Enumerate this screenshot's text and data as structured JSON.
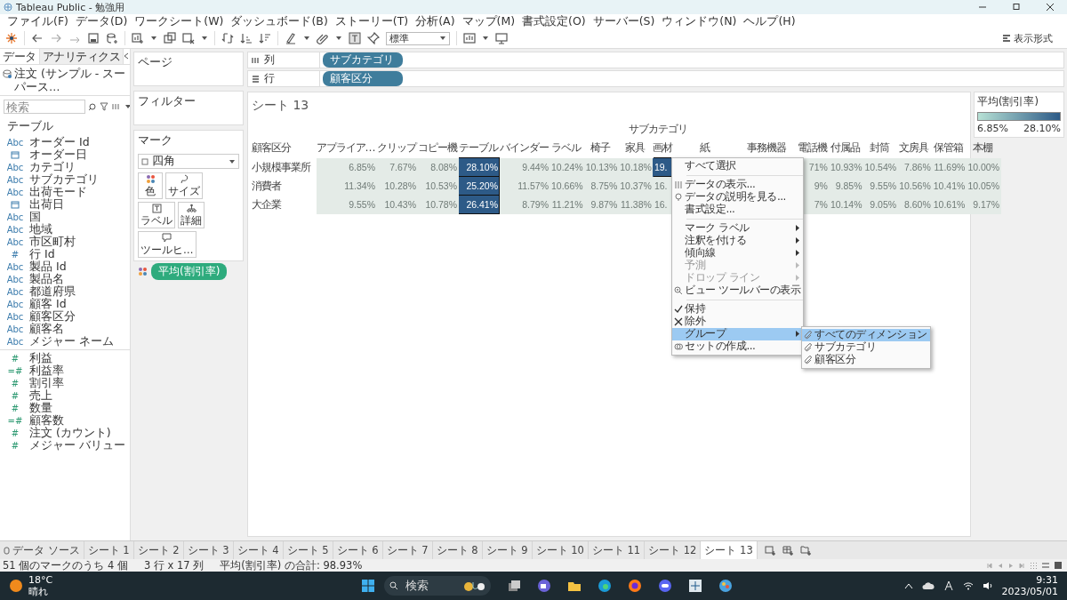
{
  "window": {
    "title": "Tableau Public - 勉強用"
  },
  "menu_bar": [
    "ファイル(F)",
    "データ(D)",
    "ワークシート(W)",
    "ダッシュボード(B)",
    "ストーリー(T)",
    "分析(A)",
    "マップ(M)",
    "書式設定(O)",
    "サーバー(S)",
    "ウィンドウ(N)",
    "ヘルプ(H)"
  ],
  "toolbar": {
    "mark_type_dropdown": "標準",
    "show_me": "表示形式"
  },
  "data_pane": {
    "tabs": [
      {
        "label": "データ",
        "selected": true
      },
      {
        "label": "アナリティクス",
        "selected": false
      }
    ],
    "data_source": "注文 (サンプル - スーパース…",
    "search": {
      "placeholder": "検索"
    },
    "section": "テーブル",
    "fields": [
      {
        "name": "オーダー Id",
        "kind": "dimension",
        "badge": "Abc"
      },
      {
        "name": "オーダー日",
        "kind": "date"
      },
      {
        "name": "カテゴリ",
        "kind": "dimension",
        "badge": "Abc"
      },
      {
        "name": "サブカテゴリ",
        "kind": "dimension",
        "badge": "Abc"
      },
      {
        "name": "出荷モード",
        "kind": "dimension",
        "badge": "Abc"
      },
      {
        "name": "出荷日",
        "kind": "date"
      },
      {
        "name": "国",
        "kind": "dimension",
        "badge": "Abc"
      },
      {
        "name": "地域",
        "kind": "dimension",
        "badge": "Abc"
      },
      {
        "name": "市区町村",
        "kind": "dimension",
        "badge": "Abc"
      },
      {
        "name": "行 Id",
        "kind": "dimension",
        "badge": "#"
      },
      {
        "name": "製品 Id",
        "kind": "dimension",
        "badge": "Abc"
      },
      {
        "name": "製品名",
        "kind": "dimension",
        "badge": "Abc"
      },
      {
        "name": "都道府県",
        "kind": "dimension",
        "badge": "Abc"
      },
      {
        "name": "顧客 Id",
        "kind": "dimension",
        "badge": "Abc"
      },
      {
        "name": "顧客区分",
        "kind": "dimension",
        "badge": "Abc"
      },
      {
        "name": "顧客名",
        "kind": "dimension",
        "badge": "Abc"
      },
      {
        "name": "メジャー ネーム",
        "kind": "dimension",
        "badge": "Abc"
      },
      {
        "name": "利益",
        "kind": "measure",
        "badge": "#"
      },
      {
        "name": "利益率",
        "kind": "measure",
        "badge": "=#"
      },
      {
        "name": "割引率",
        "kind": "measure",
        "badge": "#"
      },
      {
        "name": "売上",
        "kind": "measure",
        "badge": "#"
      },
      {
        "name": "数量",
        "kind": "measure",
        "badge": "#"
      },
      {
        "name": "顧客数",
        "kind": "measure",
        "badge": "=#"
      },
      {
        "name": "注文 (カウント)",
        "kind": "measure",
        "badge": "#"
      },
      {
        "name": "メジャー バリュー",
        "kind": "measure",
        "badge": "#"
      }
    ]
  },
  "shelves": {
    "pages": "ページ",
    "filters": "フィルター",
    "marks": {
      "title": "マーク",
      "mark_type": "四角",
      "buttons": [
        "色",
        "サイズ",
        "ラベル",
        "詳細",
        "ツールヒ…"
      ],
      "pills": [
        "平均(割引率)"
      ]
    }
  },
  "columns_shelf": {
    "label": "列",
    "pills": [
      "サブカテゴリ"
    ]
  },
  "rows_shelf": {
    "label": "行",
    "pills": [
      "顧客区分"
    ]
  },
  "sheet": {
    "title": "シート 13",
    "column_header_title": "サブカテゴリ",
    "row_header_title": "顧客区分",
    "columns": [
      "アプライア…",
      "クリップ",
      "コピー機",
      "テーブル",
      "バインダー",
      "ラベル",
      "椅子",
      "家具",
      "画材",
      "紙",
      "事務機器",
      "電話機",
      "付属品",
      "封筒",
      "文房具",
      "保管箱",
      "本棚"
    ],
    "rows": [
      {
        "name": "小規模事業所",
        "cells": [
          {
            "text": "6.85%",
            "selected": false
          },
          {
            "text": "7.67%",
            "selected": false
          },
          {
            "text": "8.08%",
            "selected": false
          },
          {
            "text": "28.10%",
            "selected": true
          },
          {
            "text": "9.44%",
            "selected": false
          },
          {
            "text": "10.24%",
            "selected": false
          },
          {
            "text": "10.13%",
            "selected": false
          },
          {
            "text": "10.18%",
            "selected": false
          },
          {
            "text": "19.",
            "selected": true
          },
          null,
          null,
          {
            "text": "71%",
            "selected": false
          },
          {
            "text": "10.93%",
            "selected": false
          },
          {
            "text": "10.54%",
            "selected": false
          },
          {
            "text": "7.86%",
            "selected": false
          },
          {
            "text": "11.69%",
            "selected": false
          },
          {
            "text": "10.00%",
            "selected": false
          }
        ]
      },
      {
        "name": "消費者",
        "cells": [
          {
            "text": "11.34%",
            "selected": false
          },
          {
            "text": "10.28%",
            "selected": false
          },
          {
            "text": "10.53%",
            "selected": false
          },
          {
            "text": "25.20%",
            "selected": true
          },
          {
            "text": "11.57%",
            "selected": false
          },
          {
            "text": "10.66%",
            "selected": false
          },
          {
            "text": "8.75%",
            "selected": false
          },
          {
            "text": "10.37%",
            "selected": false
          },
          {
            "text": "16.",
            "selected": false
          },
          null,
          null,
          {
            "text": "9%",
            "selected": false
          },
          {
            "text": "9.85%",
            "selected": false
          },
          {
            "text": "9.55%",
            "selected": false
          },
          {
            "text": "10.56%",
            "selected": false
          },
          {
            "text": "10.41%",
            "selected": false
          },
          {
            "text": "10.05%",
            "selected": false
          }
        ]
      },
      {
        "name": "大企業",
        "cells": [
          {
            "text": "9.55%",
            "selected": false
          },
          {
            "text": "10.43%",
            "selected": false
          },
          {
            "text": "10.78%",
            "selected": false
          },
          {
            "text": "26.41%",
            "selected": true
          },
          {
            "text": "8.79%",
            "selected": false
          },
          {
            "text": "11.21%",
            "selected": false
          },
          {
            "text": "9.87%",
            "selected": false
          },
          {
            "text": "11.38%",
            "selected": false
          },
          {
            "text": "16.",
            "selected": false
          },
          null,
          null,
          {
            "text": "7%",
            "selected": false
          },
          {
            "text": "10.14%",
            "selected": false
          },
          {
            "text": "9.05%",
            "selected": false
          },
          {
            "text": "8.60%",
            "selected": false
          },
          {
            "text": "10.61%",
            "selected": false
          },
          {
            "text": "9.17%",
            "selected": false
          }
        ]
      }
    ]
  },
  "legend": {
    "title": "平均(割引率)",
    "min": "6.85%",
    "max": "28.10%"
  },
  "context_menu": {
    "items": [
      {
        "kind": "item",
        "label": "すべて選択",
        "submenu": false,
        "disabled": false,
        "selected": false
      },
      {
        "kind": "separator"
      },
      {
        "kind": "item",
        "label": "データの表示...",
        "submenu": false,
        "disabled": false,
        "selected": false
      },
      {
        "kind": "item",
        "label": "データの説明を見る...",
        "submenu": false,
        "disabled": false,
        "selected": false
      },
      {
        "kind": "item",
        "label": "書式設定...",
        "submenu": false,
        "disabled": false,
        "selected": false
      },
      {
        "kind": "separator"
      },
      {
        "kind": "item",
        "label": "マーク ラベル",
        "submenu": true,
        "disabled": false,
        "selected": false
      },
      {
        "kind": "item",
        "label": "注釈を付ける",
        "submenu": true,
        "disabled": false,
        "selected": false
      },
      {
        "kind": "item",
        "label": "傾向線",
        "submenu": true,
        "disabled": false,
        "selected": false
      },
      {
        "kind": "item",
        "label": "予測",
        "submenu": true,
        "disabled": true,
        "selected": false
      },
      {
        "kind": "item",
        "label": "ドロップ ライン",
        "submenu": true,
        "disabled": true,
        "selected": false
      },
      {
        "kind": "item",
        "label": "ビュー ツールバーの表示",
        "submenu": false,
        "disabled": false,
        "selected": false
      },
      {
        "kind": "separator"
      },
      {
        "kind": "item",
        "label": "保持",
        "submenu": false,
        "disabled": false,
        "selected": false
      },
      {
        "kind": "item",
        "label": "除外",
        "submenu": false,
        "disabled": false,
        "selected": false
      },
      {
        "kind": "item",
        "label": "グループ",
        "submenu": true,
        "disabled": false,
        "selected": true
      },
      {
        "kind": "item",
        "label": "セットの作成...",
        "submenu": false,
        "disabled": false,
        "selected": false
      }
    ]
  },
  "submenu": {
    "items": [
      {
        "label": "すべてのディメンション",
        "selected": true
      },
      {
        "label": "サブカテゴリ",
        "selected": false
      },
      {
        "label": "顧客区分",
        "selected": false
      }
    ]
  },
  "sheet_tabs": [
    {
      "label": "データ ソース",
      "selected": false
    },
    {
      "label": "シート 1",
      "selected": false
    },
    {
      "label": "シート 2",
      "selected": false
    },
    {
      "label": "シート 3",
      "selected": false
    },
    {
      "label": "シート 4",
      "selected": false
    },
    {
      "label": "シート 5",
      "selected": false
    },
    {
      "label": "シート 6",
      "selected": false
    },
    {
      "label": "シート 7",
      "selected": false
    },
    {
      "label": "シート 8",
      "selected": false
    },
    {
      "label": "シート 9",
      "selected": false
    },
    {
      "label": "シート 10",
      "selected": false
    },
    {
      "label": "シート 11",
      "selected": false
    },
    {
      "label": "シート 12",
      "selected": false
    },
    {
      "label": "シート 13",
      "selected": true
    }
  ],
  "status_bar": [
    "51 個のマークのうち 4 個",
    "3 行 x 17 列",
    "平均(割引率) の合計: 98.93%"
  ],
  "taskbar": {
    "weather": {
      "temperature": "18°C",
      "condition": "晴れ"
    },
    "search": "検索",
    "time": "9:31",
    "date": "2023/05/01"
  }
}
